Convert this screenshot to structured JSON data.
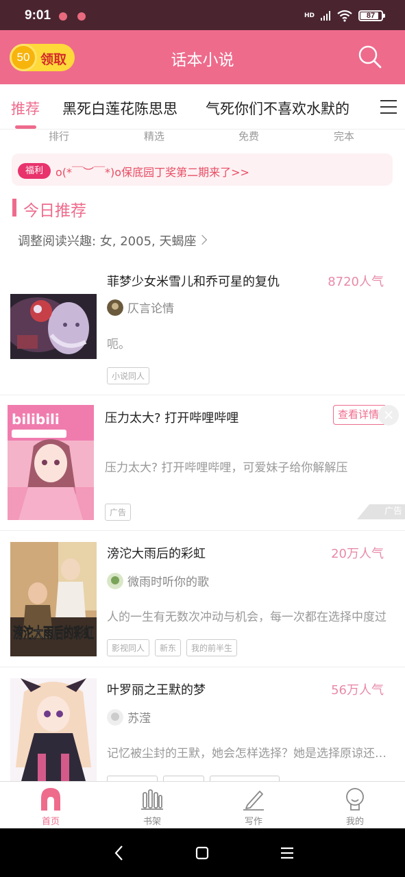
{
  "status_bar": {
    "time": "9:01",
    "network_label": "HD",
    "battery": "87"
  },
  "header": {
    "coin_amount": "50",
    "coin_label": "领取",
    "title": "话本小说"
  },
  "tabs": [
    {
      "label": "推荐",
      "active": true
    },
    {
      "label": "黑死白莲花陈思思"
    },
    {
      "label": "气死你们不喜欢水默的"
    }
  ],
  "subcategories": [
    "排行",
    "精选",
    "免费",
    "完本"
  ],
  "banner": {
    "tag": "福利",
    "text": "o(*￣︶￣*)o保底园丁奖第二期来了>>"
  },
  "section": {
    "title": "今日推荐",
    "interest_text": "调整阅读兴趣: 女, 2005, 天蝎座"
  },
  "books": [
    {
      "title": "菲梦少女米雪儿和乔可星的复仇",
      "popularity": "8720人气",
      "author": "仄言论情",
      "description": "呃。",
      "tags": [
        "小说同人"
      ]
    },
    {
      "title": "滂沱大雨后的彩虹",
      "popularity": "20万人气",
      "author": "微雨时听你的歌",
      "description": "人的一生有无数次冲动与机会，每一次都在选择中度过",
      "tags": [
        "影视同人",
        "新东",
        "我的前半生"
      ],
      "cover_text": "滂沱大雨后的彩虹"
    },
    {
      "title": "叶罗丽之王默的梦",
      "popularity": "56万人气",
      "author": "苏滢",
      "description": "记忆被尘封的王默，她会怎样选择？她是选择原谅还是复仇",
      "tags": [
        "",
        "",
        ""
      ]
    }
  ],
  "ad": {
    "title": "压力太大? 打开哔哩哔哩",
    "description": "压力太大? 打开哔哩哔哩，可爱妹子给你解解压",
    "view_button": "查看详情",
    "tag": "广告",
    "corner_label": "广告",
    "close": "×",
    "cover_brand": "bilibili"
  },
  "bottom_nav": [
    {
      "label": "首页",
      "icon": "home-icon",
      "active": true
    },
    {
      "label": "书架",
      "icon": "bookshelf-icon"
    },
    {
      "label": "写作",
      "icon": "pen-icon"
    },
    {
      "label": "我的",
      "icon": "profile-icon"
    }
  ],
  "colors": {
    "primary": "#ee6b8c",
    "status_bar": "#4a2530",
    "coin": "#ffd93a",
    "popularity": "#e88aa8"
  }
}
